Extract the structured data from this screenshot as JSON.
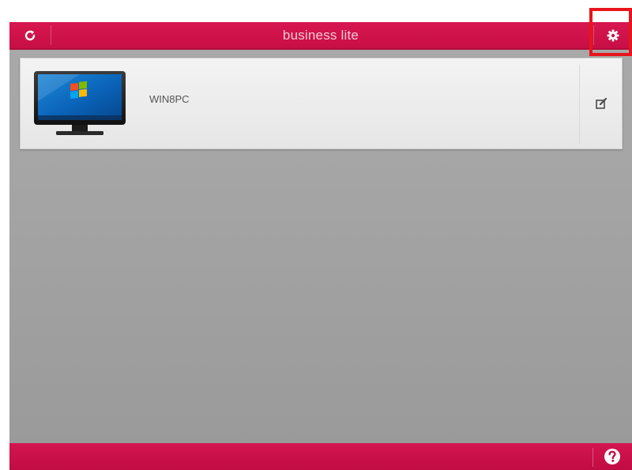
{
  "header": {
    "title": "business lite",
    "refresh_icon": "refresh-icon",
    "settings_icon": "gear-icon"
  },
  "devices": [
    {
      "name": "WIN8PC",
      "icon": "monitor-icon",
      "action_icon": "edit-icon"
    }
  ],
  "footer": {
    "help_icon": "help-icon"
  },
  "colors": {
    "accent": "#d31550",
    "background": "#a5a5a5",
    "highlight": "#e8141c"
  }
}
